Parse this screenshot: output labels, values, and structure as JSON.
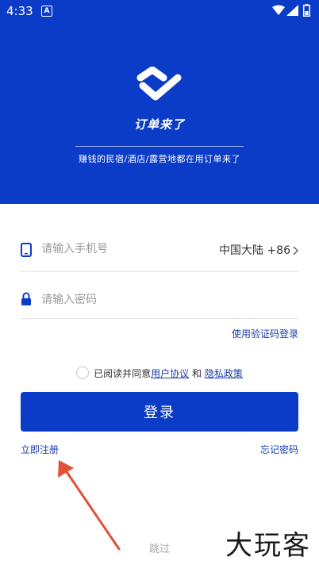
{
  "colors": {
    "brand": "#0a3cc7",
    "link": "#1a3fa8",
    "annotation_arrow": "#e0503a"
  },
  "status_bar": {
    "time": "4:33",
    "notification_badge": "A",
    "icons": [
      "wifi-icon",
      "signal-icon",
      "battery-icon"
    ]
  },
  "hero": {
    "logo_icon": "order-logo-icon",
    "brand_name": "订单来了",
    "slogan": "赚钱的民宿/酒店/露营地都在用订单来了"
  },
  "form": {
    "phone": {
      "icon": "phone-icon",
      "placeholder": "请输入手机号",
      "value": ""
    },
    "country_code": "中国大陆 +86",
    "password": {
      "icon": "lock-icon",
      "placeholder": "请输入密码",
      "value": ""
    },
    "sms_login_label": "使用验证码登录"
  },
  "agreement": {
    "prefix": "已阅读并同意",
    "user_agreement": "用户协议",
    "and": "和",
    "privacy_policy": "隐私政策"
  },
  "login_label": "登录",
  "register_label": "立即注册",
  "forgot_label": "忘记密码",
  "skip_label": "跳过",
  "watermark": "大玩客"
}
